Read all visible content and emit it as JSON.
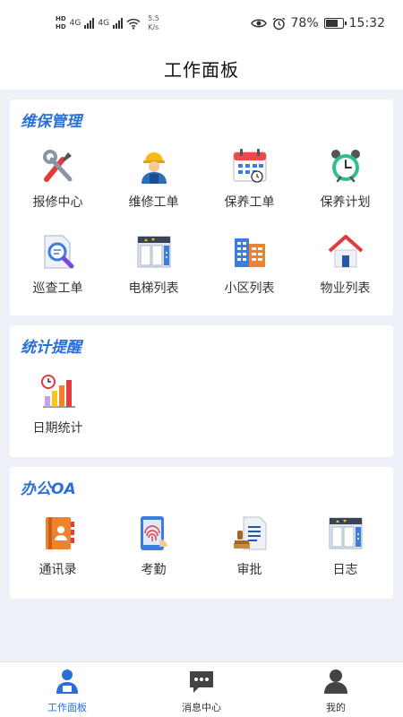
{
  "status_bar": {
    "hd1": "HD",
    "hd2": "HD",
    "net1": "4G",
    "net2": "4G",
    "speed_value": "5.5",
    "speed_unit": "K/s",
    "battery": "78%",
    "battery_level": 0.78,
    "time": "15:32"
  },
  "header": {
    "title": "工作面板"
  },
  "sections": [
    {
      "title": "维保管理",
      "items": [
        {
          "label": "报修中心",
          "icon": "tools-icon"
        },
        {
          "label": "维修工单",
          "icon": "worker-icon"
        },
        {
          "label": "保养工单",
          "icon": "calendar-icon"
        },
        {
          "label": "保养计划",
          "icon": "alarm-clock-icon"
        },
        {
          "label": "巡查工单",
          "icon": "document-search-icon"
        },
        {
          "label": "电梯列表",
          "icon": "elevator-icon"
        },
        {
          "label": "小区列表",
          "icon": "buildings-icon"
        },
        {
          "label": "物业列表",
          "icon": "house-icon"
        }
      ]
    },
    {
      "title": "统计提醒",
      "items": [
        {
          "label": "日期统计",
          "icon": "bar-chart-clock-icon"
        }
      ]
    },
    {
      "title": "办公OA",
      "items": [
        {
          "label": "通讯录",
          "icon": "contacts-book-icon"
        },
        {
          "label": "考勤",
          "icon": "fingerprint-icon"
        },
        {
          "label": "审批",
          "icon": "stamp-document-icon"
        },
        {
          "label": "日志",
          "icon": "elevator-log-icon"
        }
      ]
    }
  ],
  "tabbar": {
    "tabs": [
      {
        "label": "工作面板",
        "icon": "workbench-icon",
        "active": true
      },
      {
        "label": "消息中心",
        "icon": "message-icon",
        "active": false
      },
      {
        "label": "我的",
        "icon": "user-icon",
        "active": false
      }
    ]
  },
  "colors": {
    "accent": "#2a6fd6",
    "background": "#eef2f8"
  }
}
